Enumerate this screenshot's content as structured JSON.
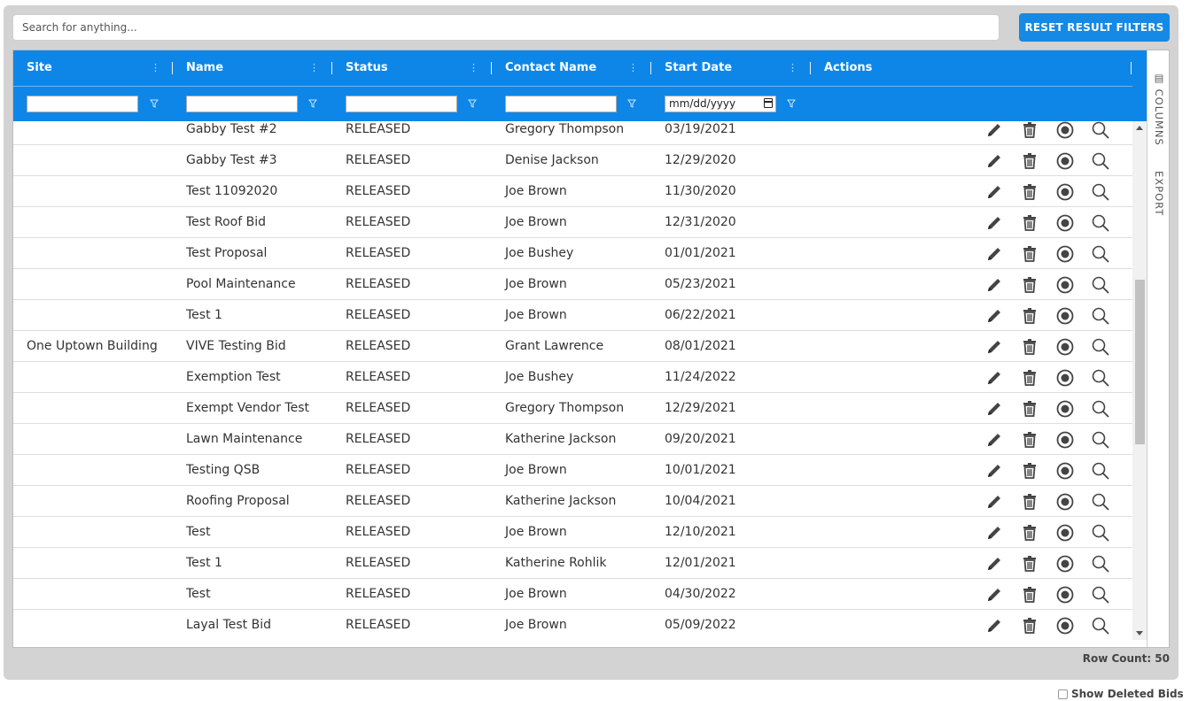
{
  "search": {
    "placeholder": "Search for anything..."
  },
  "reset_button_label": "RESET RESULT FILTERS",
  "columns": [
    {
      "key": "site",
      "label": "Site"
    },
    {
      "key": "name",
      "label": "Name"
    },
    {
      "key": "status",
      "label": "Status"
    },
    {
      "key": "contact",
      "label": "Contact Name"
    },
    {
      "key": "start",
      "label": "Start Date"
    },
    {
      "key": "actions",
      "label": "Actions"
    }
  ],
  "filters": {
    "date_placeholder": "mm/dd/yyyy"
  },
  "side_tabs": {
    "columns": "COLUMNS",
    "export": "EXPORT"
  },
  "rows": [
    {
      "site": "",
      "name": "Gabby Test #2",
      "status": "RELEASED",
      "contact": "Gregory Thompson",
      "start": "03/19/2021"
    },
    {
      "site": "",
      "name": "Gabby Test #3",
      "status": "RELEASED",
      "contact": "Denise Jackson",
      "start": "12/29/2020"
    },
    {
      "site": "",
      "name": "Test 11092020",
      "status": "RELEASED",
      "contact": "Joe Brown",
      "start": "11/30/2020"
    },
    {
      "site": "",
      "name": "Test Roof Bid",
      "status": "RELEASED",
      "contact": "Joe Brown",
      "start": "12/31/2020"
    },
    {
      "site": "",
      "name": "Test Proposal",
      "status": "RELEASED",
      "contact": "Joe Bushey",
      "start": "01/01/2021"
    },
    {
      "site": "",
      "name": "Pool Maintenance",
      "status": "RELEASED",
      "contact": "Joe Brown",
      "start": "05/23/2021"
    },
    {
      "site": "",
      "name": "Test 1",
      "status": "RELEASED",
      "contact": "Joe Brown",
      "start": "06/22/2021"
    },
    {
      "site": "One Uptown Building",
      "name": "VIVE Testing Bid",
      "status": "RELEASED",
      "contact": "Grant Lawrence",
      "start": "08/01/2021"
    },
    {
      "site": "",
      "name": "Exemption Test",
      "status": "RELEASED",
      "contact": "Joe Bushey",
      "start": "11/24/2022"
    },
    {
      "site": "",
      "name": "Exempt Vendor Test",
      "status": "RELEASED",
      "contact": "Gregory Thompson",
      "start": "12/29/2021"
    },
    {
      "site": "",
      "name": "Lawn Maintenance",
      "status": "RELEASED",
      "contact": "Katherine Jackson",
      "start": "09/20/2021"
    },
    {
      "site": "",
      "name": "Testing QSB",
      "status": "RELEASED",
      "contact": "Joe Brown",
      "start": "10/01/2021"
    },
    {
      "site": "",
      "name": "Roofing Proposal",
      "status": "RELEASED",
      "contact": "Katherine Jackson",
      "start": "10/04/2021"
    },
    {
      "site": "",
      "name": "Test",
      "status": "RELEASED",
      "contact": "Joe Brown",
      "start": "12/10/2021"
    },
    {
      "site": "",
      "name": "Test 1",
      "status": "RELEASED",
      "contact": "Katherine Rohlik",
      "start": "12/01/2021"
    },
    {
      "site": "",
      "name": "Test",
      "status": "RELEASED",
      "contact": "Joe Brown",
      "start": "04/30/2022"
    },
    {
      "site": "",
      "name": "Layal Test Bid",
      "status": "RELEASED",
      "contact": "Joe Brown",
      "start": "05/09/2022"
    }
  ],
  "row_count_label": "Row Count: 50",
  "show_deleted_label": "Show Deleted Bids",
  "colors": {
    "header_bg": "#0e86e8",
    "button_bg": "#1489e6",
    "panel_bg": "#d3d3d3",
    "icon": "#444444"
  }
}
